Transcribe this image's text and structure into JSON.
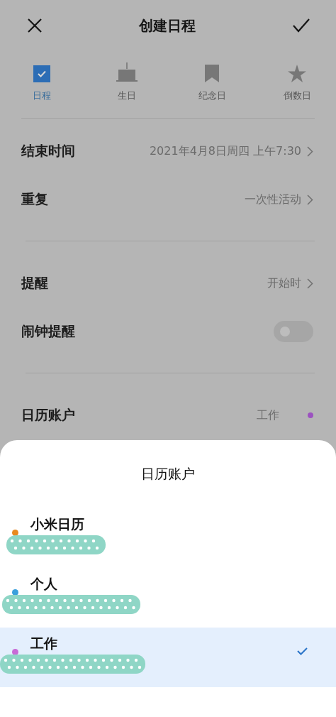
{
  "header": {
    "title": "创建日程"
  },
  "tabs": [
    {
      "label": "日程",
      "kind": "checkbox",
      "selected": true
    },
    {
      "label": "生日",
      "kind": "cake",
      "selected": false
    },
    {
      "label": "纪念日",
      "kind": "bookmark",
      "selected": false
    },
    {
      "label": "倒数日",
      "kind": "star",
      "selected": false
    }
  ],
  "groups": [
    [
      {
        "kind": "link",
        "label": "结束时间",
        "value": "2021年4月8日周四 上午7:30"
      },
      {
        "kind": "link",
        "label": "重复",
        "value": "一次性活动"
      }
    ],
    [
      {
        "kind": "link",
        "label": "提醒",
        "value": "开始时"
      },
      {
        "kind": "toggle",
        "label": "闹钟提醒",
        "on": false
      }
    ],
    [
      {
        "kind": "account",
        "label": "日历账户",
        "value": "工作",
        "color": "#9c52c0"
      }
    ]
  ],
  "sheet": {
    "title": "日历账户",
    "items": [
      {
        "name": "小米日历",
        "color": "#e88a1e",
        "selected": false
      },
      {
        "name": "个人",
        "color": "#3aa0dc",
        "selected": false
      },
      {
        "name": "工作",
        "color": "#c86ad6",
        "selected": true
      }
    ]
  }
}
